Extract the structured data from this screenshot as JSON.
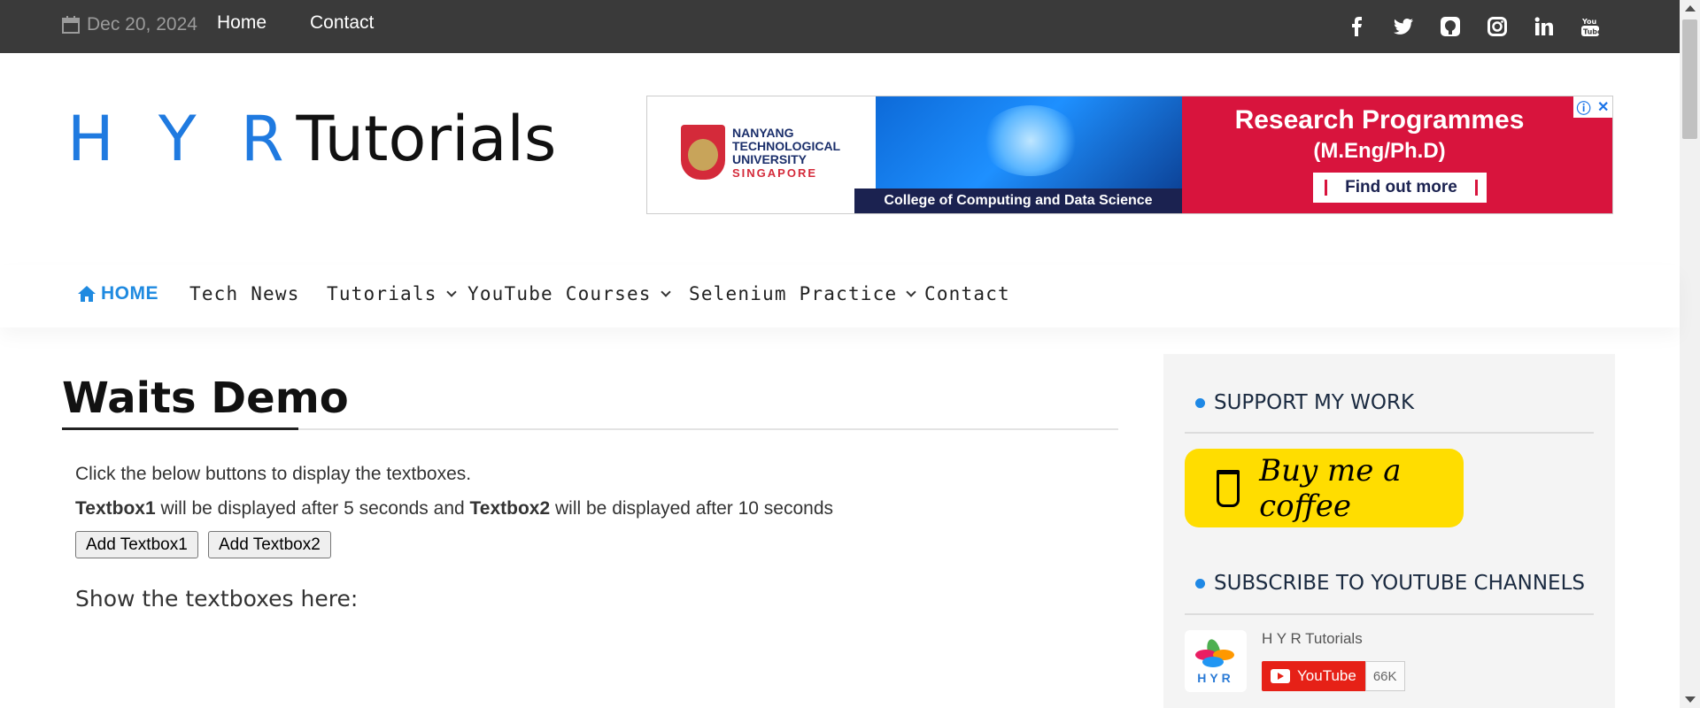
{
  "topbar": {
    "date": "Dec 20, 2024",
    "links": [
      "Home",
      "Contact"
    ],
    "social": {
      "facebook": "f",
      "twitter": "t",
      "github": "g",
      "instagram": "i",
      "linkedin": "in",
      "youtube": "yt"
    }
  },
  "logo": {
    "hyr": "H Y R",
    "tutorials": "Tutorials"
  },
  "ad": {
    "university_line1": "NANYANG",
    "university_line2": "TECHNOLOGICAL",
    "university_line3": "UNIVERSITY",
    "university_line4": "SINGAPORE",
    "caption": "College of Computing and Data Science",
    "headline": "Research Programmes",
    "subheadline": "(M.Eng/Ph.D)",
    "cta": "Find out more",
    "info_icon": "ⓘ",
    "close_icon": "✕"
  },
  "nav": {
    "home": "HOME",
    "tech_news": "Tech News",
    "tutorials": "Tutorials",
    "youtube_courses": "YouTube Courses",
    "selenium_practice": "Selenium Practice",
    "contact": "Contact"
  },
  "content": {
    "title": "Waits Demo",
    "intro": "Click the below buttons to display the textboxes.",
    "textbox1_label": "Textbox1",
    "mid_text": " will be displayed after 5 seconds and ",
    "textbox2_label": "Textbox2",
    "end_text": " will be displayed after 10 seconds",
    "button1": "Add Textbox1",
    "button2": "Add Textbox2",
    "show_label": "Show the textboxes here:"
  },
  "sidebar": {
    "support_title": "SUPPORT MY WORK",
    "buy_coffee": "Buy me a coffee",
    "subscribe_title": "SUBSCRIBE TO YOUTUBE CHANNELS",
    "channel_name": "H Y R Tutorials",
    "channel_logo_text": "HYR",
    "youtube_label": "YouTube",
    "subscriber_count": "66K"
  },
  "colors": {
    "topbar": "#3a3a3a",
    "accent": "#1f8ae0",
    "coffee_yellow": "#ffdd00",
    "youtube_red": "#e62117",
    "ad_red": "#d8143d"
  }
}
